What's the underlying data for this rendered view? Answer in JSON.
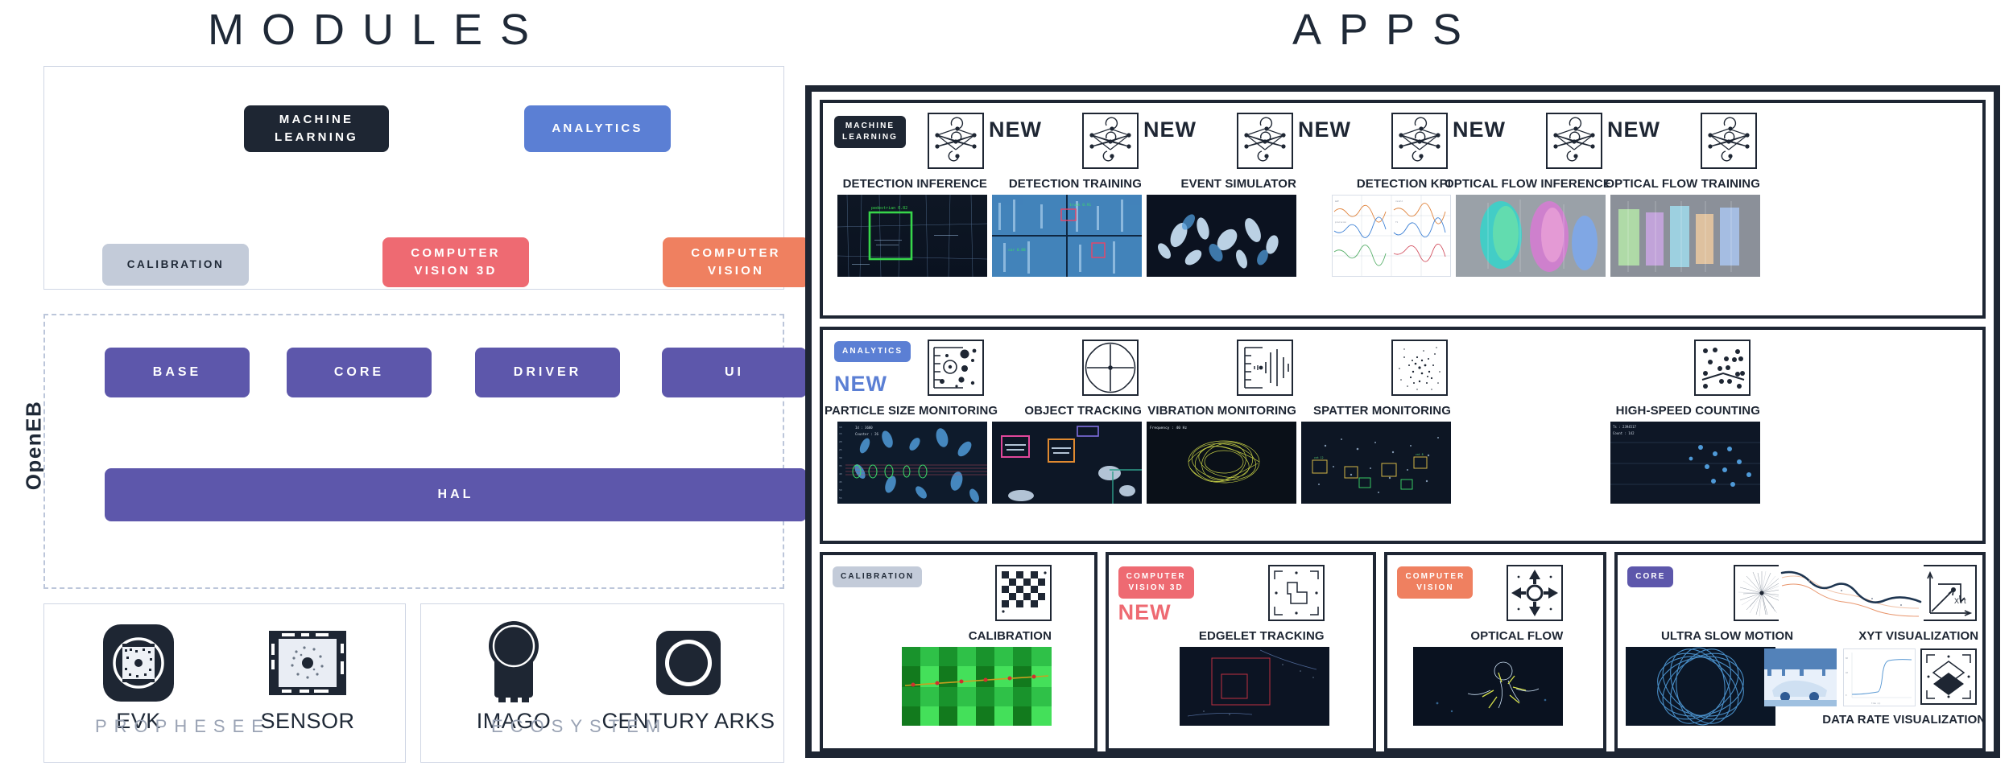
{
  "titles": {
    "modules": "MODULES",
    "apps": "APPS"
  },
  "modules": {
    "stack_label": "OpenEB",
    "top_chips": [
      {
        "label": "MACHINE\nLEARNING",
        "color": "#1e2633"
      },
      {
        "label": "ANALYTICS",
        "color": "#5b7fd4"
      },
      {
        "label": "CALIBRATION",
        "color": "#c3cbd9"
      },
      {
        "label": "COMPUTER\nVISION 3D",
        "color": "#ee6a72"
      },
      {
        "label": "COMPUTER\nVISION",
        "color": "#ef8060"
      }
    ],
    "openeb_chips": [
      {
        "label": "BASE",
        "color": "#5d57ab"
      },
      {
        "label": "CORE",
        "color": "#5d57ab"
      },
      {
        "label": "DRIVER",
        "color": "#5d57ab"
      },
      {
        "label": "UI",
        "color": "#5d57ab"
      },
      {
        "label": "HAL",
        "color": "#5d57ab"
      }
    ],
    "hardware": [
      {
        "label": "EVK",
        "icon": "evk-device-icon",
        "group": "PROPHESEE"
      },
      {
        "label": "SENSOR",
        "icon": "sensor-chip-icon",
        "group": "PROPHESEE"
      },
      {
        "label": "IMAGO",
        "icon": "imago-camera-icon",
        "group": "ECOSYSTEM"
      },
      {
        "label": "CENTURY ARKS",
        "icon": "century-arks-camera-icon",
        "group": "ECOSYSTEM"
      }
    ],
    "group_labels": {
      "prophesee": "PROPHESEE",
      "ecosystem": "ECOSYSTEM"
    }
  },
  "apps": {
    "new_label": "NEW",
    "rows": [
      {
        "category": {
          "label": "MACHINE\nLEARNING",
          "color": "#1e2633",
          "text_color": "#ffffff"
        },
        "new_color": "#1e2633",
        "cards": [
          {
            "name": "DETECTION INFERENCE",
            "icon": "neural-network-icon",
            "new": false,
            "thumb": "detection-inference-thumb"
          },
          {
            "name": "DETECTION TRAINING",
            "icon": "neural-network-icon",
            "new": true,
            "thumb": "detection-training-thumb"
          },
          {
            "name": "EVENT SIMULATOR",
            "icon": "neural-network-icon",
            "new": true,
            "thumb": "event-simulator-thumb"
          },
          {
            "name": "DETECTION KPI",
            "icon": "neural-network-icon",
            "new": true,
            "thumb": "detection-kpi-thumb"
          },
          {
            "name": "OPTICAL FLOW INFERENCE",
            "icon": "neural-network-icon",
            "new": true,
            "thumb": "optical-flow-inference-thumb"
          },
          {
            "name": "OPTICAL FLOW TRAINING",
            "icon": "neural-network-icon",
            "new": true,
            "thumb": "optical-flow-training-thumb"
          }
        ]
      },
      {
        "category": {
          "label": "ANALYTICS",
          "color": "#5b7fd4",
          "text_color": "#ffffff"
        },
        "new_color": "#5b7fd4",
        "cards": [
          {
            "name": "PARTICLE SIZE MONITORING",
            "icon": "particle-size-icon",
            "new": true,
            "thumb": "particle-size-thumb"
          },
          {
            "name": "OBJECT TRACKING",
            "icon": "crosshair-icon",
            "new": false,
            "thumb": "object-tracking-thumb"
          },
          {
            "name": "VIBRATION MONITORING",
            "icon": "vibration-icon",
            "new": false,
            "thumb": "vibration-thumb"
          },
          {
            "name": "SPATTER MONITORING",
            "icon": "spatter-icon",
            "new": false,
            "thumb": "spatter-thumb"
          },
          {
            "name": "HIGH-SPEED COUNTING",
            "icon": "high-speed-counting-icon",
            "new": false,
            "thumb": "high-speed-counting-thumb"
          }
        ]
      },
      {
        "groups": [
          {
            "category": {
              "label": "CALIBRATION",
              "color": "#c3cbd9",
              "text_color": "#1f2937"
            },
            "new_color": "#1e2633",
            "cards": [
              {
                "name": "CALIBRATION",
                "icon": "checkerboard-icon",
                "new": false,
                "thumb": "calibration-thumb"
              }
            ]
          },
          {
            "category": {
              "label": "COMPUTER\nVISION 3D",
              "color": "#ee6a72",
              "text_color": "#ffffff"
            },
            "new_color": "#ee6a72",
            "cards": [
              {
                "name": "EDGELET TRACKING",
                "icon": "edgelet-icon",
                "new": true,
                "thumb": "edgelet-tracking-thumb"
              }
            ]
          },
          {
            "category": {
              "label": "COMPUTER\nVISION",
              "color": "#ef8060",
              "text_color": "#ffffff"
            },
            "new_color": "#ef8060",
            "cards": [
              {
                "name": "OPTICAL FLOW",
                "icon": "optical-flow-arrows-icon",
                "new": false,
                "thumb": "optical-flow-thumb"
              }
            ]
          },
          {
            "category": {
              "label": "CORE",
              "color": "#5d57ab",
              "text_color": "#ffffff"
            },
            "new_color": "#5d57ab",
            "cards": [
              {
                "name": "ULTRA SLOW MOTION",
                "icon": "radial-burst-icon",
                "new": false,
                "thumb": "ultra-slow-motion-thumb"
              },
              {
                "name": "XYT VISUALIZATION",
                "icon": "xyt-axes-icon",
                "new": false,
                "thumb": "xyt-visualization-thumb"
              },
              {
                "name": "DATA RATE VISUALIZATION",
                "icon": "data-rate-diamond-icon",
                "new": false,
                "thumb": "data-rate-thumb"
              }
            ]
          }
        ]
      }
    ]
  },
  "colors": {
    "dark": "#1e2633",
    "blue": "#5b7fd4",
    "purple": "#5d57ab",
    "red": "#ee6a72",
    "orange": "#ef8060",
    "gray": "#c3cbd9",
    "panel_border": "#cfd6e4",
    "muted_text": "#9aa3b4"
  }
}
